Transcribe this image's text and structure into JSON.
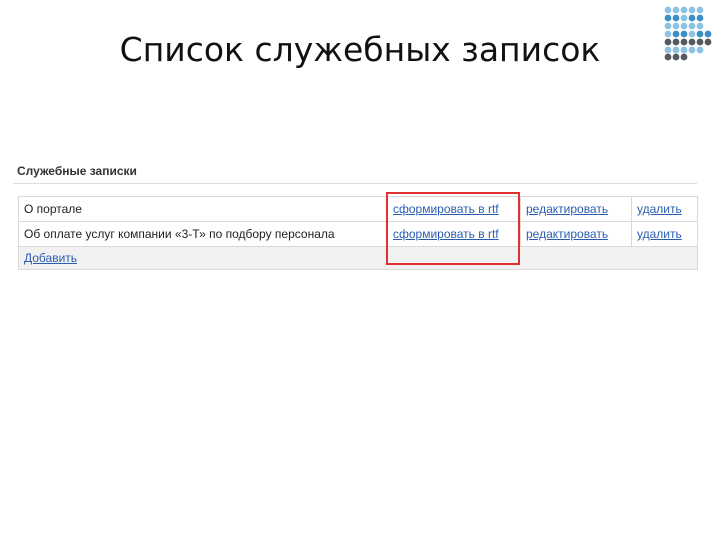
{
  "slide": {
    "title": "Список служебных записок"
  },
  "panel": {
    "title": "Служебные записки",
    "rows": [
      {
        "name": "О портале",
        "rtf_link": "сформировать в rtf",
        "edit_link": "редактировать",
        "delete_link": "удалить"
      },
      {
        "name": "Об оплате услуг компании «3-Т» по подбору персонала",
        "rtf_link": "сформировать в rtf",
        "edit_link": "редактировать",
        "delete_link": "удалить"
      }
    ],
    "add_link": "Добавить"
  },
  "colors": {
    "link": "#2a5db0",
    "highlight": "#e03030",
    "logo_blue": "#3b8fc4",
    "logo_light": "#8cc3e3",
    "logo_gray": "#555a60"
  },
  "icons": {
    "logo": "dot-grid-logo"
  }
}
